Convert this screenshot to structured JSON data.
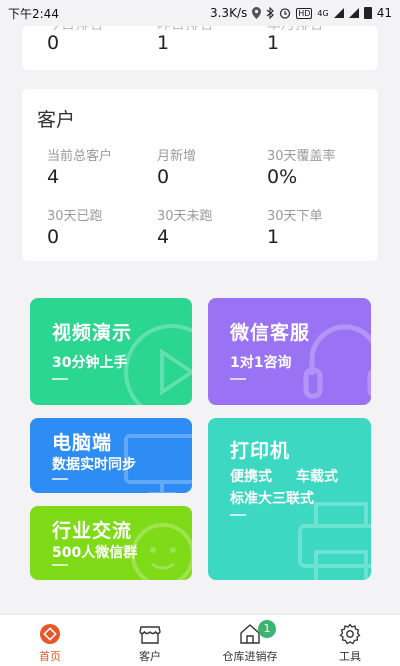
{
  "status_bar": {
    "time": "下午2:44",
    "speed": "3.3K/s",
    "hd": "HD",
    "net": "4G",
    "battery": "41"
  },
  "top_card": {
    "labels": [
      "今日排名",
      "昨日排名",
      "本月排名"
    ],
    "values": [
      "0",
      "1",
      "1"
    ]
  },
  "customer": {
    "title": "客户",
    "stats": [
      {
        "label": "当前总客户",
        "value": "4"
      },
      {
        "label": "月新增",
        "value": "0"
      },
      {
        "label": "30天覆盖率",
        "value": "0%"
      },
      {
        "label": "30天已跑",
        "value": "0"
      },
      {
        "label": "30天未跑",
        "value": "4"
      },
      {
        "label": "30天下单",
        "value": "1"
      }
    ]
  },
  "tiles": {
    "video": {
      "title": "视频演示",
      "sub": "30分钟上手"
    },
    "wechat": {
      "title": "微信客服",
      "sub": "1对1咨询"
    },
    "pc": {
      "title": "电脑端",
      "sub": "数据实时同步"
    },
    "print": {
      "title": "打印机",
      "sub1": "便携式",
      "sub2": "车载式",
      "sub3": "标准大三联式"
    },
    "industry": {
      "title": "行业交流",
      "sub": "500人微信群"
    }
  },
  "tabbar": {
    "items": [
      {
        "label": "首页",
        "icon": "home-diamond-icon"
      },
      {
        "label": "客户",
        "icon": "store-icon"
      },
      {
        "label": "仓库进销存",
        "icon": "warehouse-icon",
        "badge": "1"
      },
      {
        "label": "工具",
        "icon": "gear-icon"
      }
    ],
    "active_color": "#e8572a"
  }
}
